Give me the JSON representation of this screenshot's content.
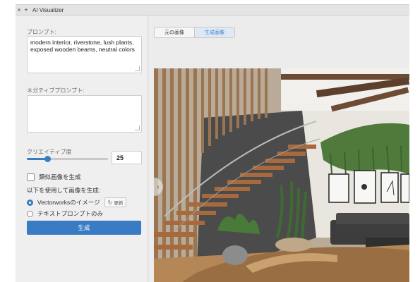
{
  "window": {
    "title": "AI Visualizer",
    "close_icon": "×",
    "add_icon": "+"
  },
  "prompt": {
    "label": "プロンプト:",
    "value": "modern interior, riverstone, lush plants, exposed wooden beams, neutral colors"
  },
  "negative_prompt": {
    "label": "ネガティブプロンプト:",
    "value": ""
  },
  "creativity": {
    "label": "クリエイティブ度",
    "value": "25",
    "fraction": 0.25
  },
  "similar_images": {
    "label": "類似画像を生成",
    "checked": false
  },
  "source": {
    "label": "以下を使用して画像を生成:",
    "options": [
      {
        "label": "Vectorworksのイメージ",
        "selected": true
      },
      {
        "label": "テキストプロンプトのみ",
        "selected": false
      }
    ],
    "refresh_label": "更新",
    "refresh_icon": "refresh-icon"
  },
  "generate_button": "生成",
  "tabs": [
    {
      "label": "元の画像",
      "active": false
    },
    {
      "label": "生成画像",
      "active": true
    }
  ],
  "colors": {
    "accent": "#3a7cc4",
    "panel": "#efefef"
  }
}
